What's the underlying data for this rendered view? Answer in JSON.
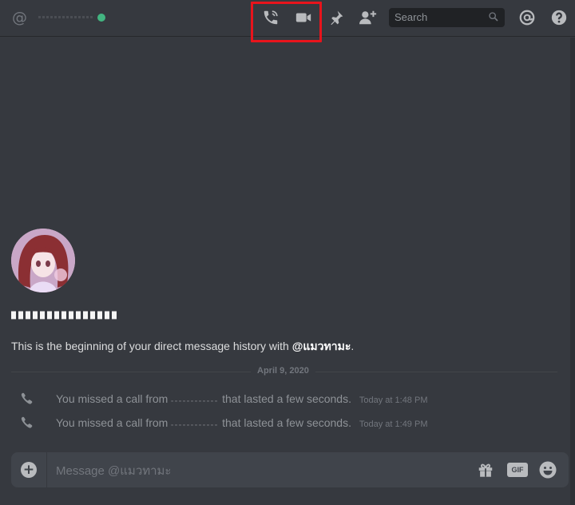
{
  "header": {
    "search_placeholder": "Search",
    "status_color": "#43b581"
  },
  "intro": {
    "text_before": "This is the beginning of your direct message history with ",
    "mention": "@แมวทามะ",
    "text_after": "."
  },
  "divider": {
    "date": "April 9, 2020"
  },
  "calls": [
    {
      "prefix": "You missed a call from",
      "suffix": "that lasted a few seconds.",
      "time": "Today at 1:48 PM"
    },
    {
      "prefix": "You missed a call from",
      "suffix": "that lasted a few seconds.",
      "time": "Today at 1:49 PM"
    }
  ],
  "composer": {
    "placeholder": "Message @แมวทามะ",
    "gif_label": "GIF"
  },
  "colors": {
    "background": "#36393f",
    "highlight": "#e8141c",
    "online": "#43b581"
  },
  "icons": [
    "at-icon",
    "voice-call-icon",
    "video-call-icon",
    "pin-icon",
    "add-friend-icon",
    "search-icon",
    "mentions-icon",
    "help-icon",
    "phone-icon",
    "add-attachment-icon",
    "gift-icon",
    "gif-icon",
    "emoji-icon"
  ]
}
